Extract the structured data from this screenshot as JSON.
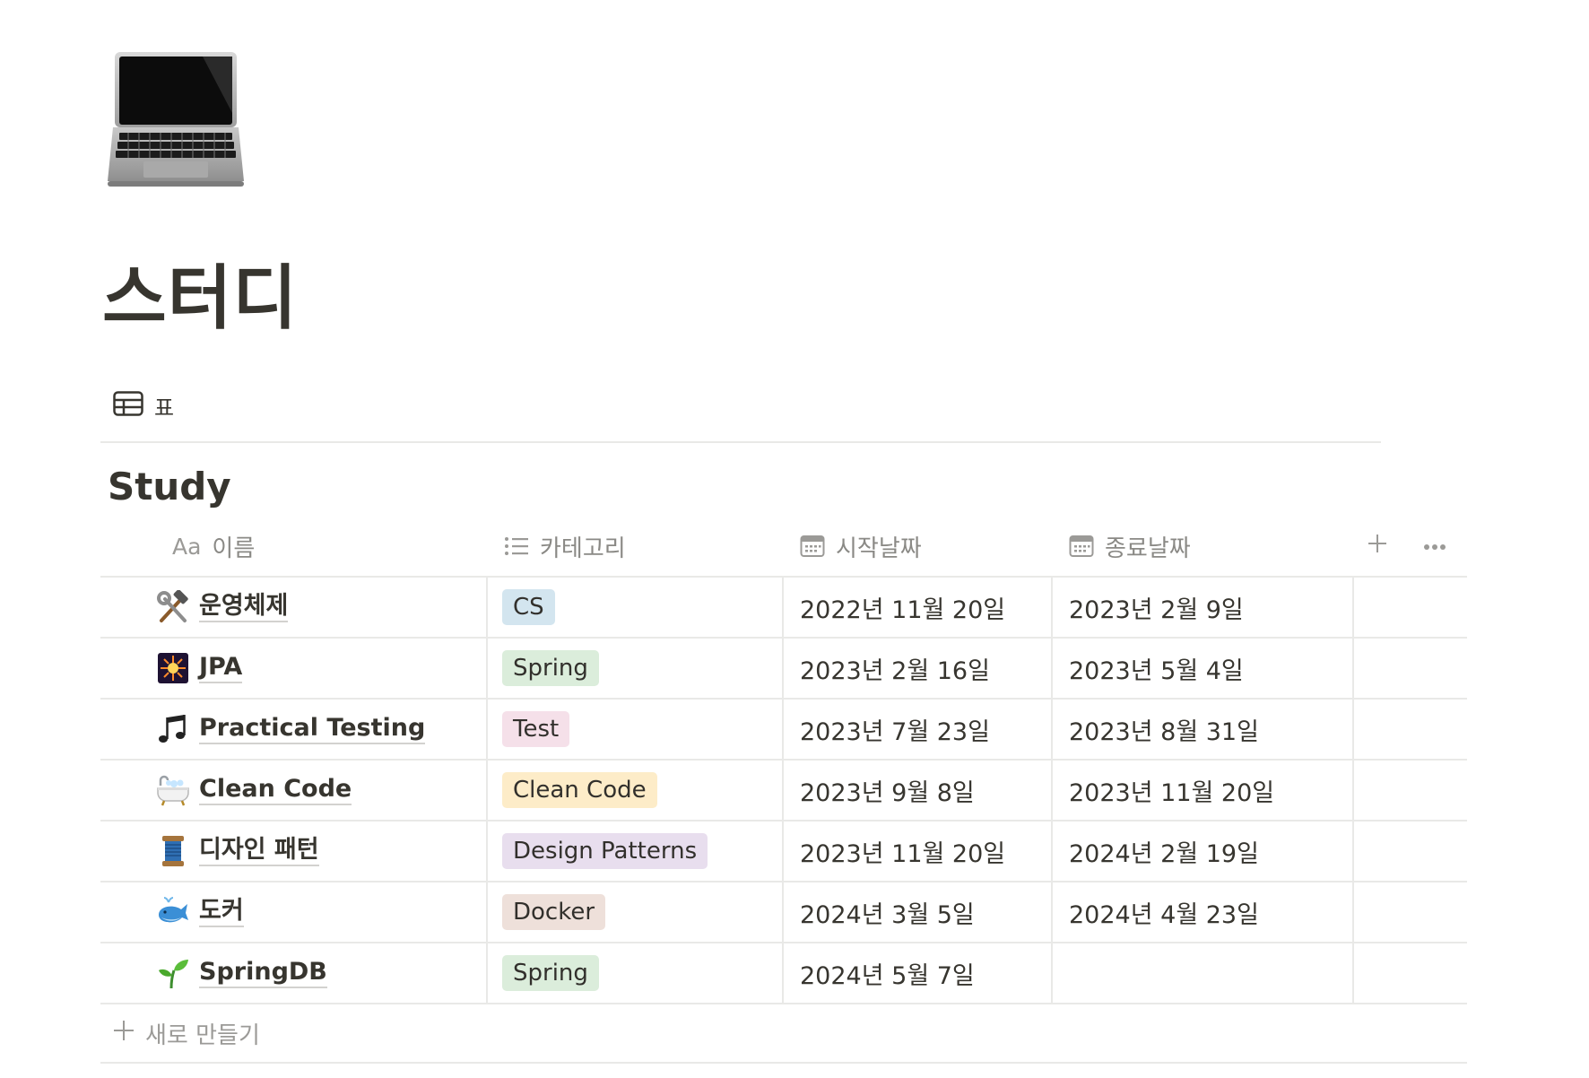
{
  "page": {
    "icon": "laptop-icon",
    "title": "스터디"
  },
  "view": {
    "tab_label": "표",
    "icon": "table-icon"
  },
  "database": {
    "title": "Study",
    "columns": [
      {
        "key": "name",
        "label": "이름",
        "type_icon": "Aa"
      },
      {
        "key": "category",
        "label": "카테고리",
        "type_icon": "list-icon"
      },
      {
        "key": "start",
        "label": "시작날짜",
        "type_icon": "calendar-icon"
      },
      {
        "key": "end",
        "label": "종료날짜",
        "type_icon": "calendar-icon"
      }
    ],
    "add_column_icon": "plus-icon",
    "more_icon": "more-icon",
    "rows": [
      {
        "icon": "hammer-wrench-icon",
        "name": "운영체제",
        "category": "CS",
        "tag_color": "#d3e5ef",
        "start": "2022년 11월 20일",
        "end": "2023년 2월 9일"
      },
      {
        "icon": "sparkler-icon",
        "name": "JPA",
        "category": "Spring",
        "tag_color": "#dbeddb",
        "start": "2023년 2월 16일",
        "end": "2023년 5월 4일"
      },
      {
        "icon": "music-notes-icon",
        "name": "Practical Testing",
        "category": "Test",
        "tag_color": "#f5e0e9",
        "start": "2023년 7월 23일",
        "end": "2023년 8월 31일"
      },
      {
        "icon": "bathtub-icon",
        "name": "Clean Code",
        "category": "Clean Code",
        "tag_color": "#fdecc8",
        "start": "2023년 9월 8일",
        "end": "2023년 11월 20일"
      },
      {
        "icon": "thread-spool-icon",
        "name": "디자인 패턴",
        "category": "Design Patterns",
        "tag_color": "#e8deee",
        "start": "2023년 11월 20일",
        "end": "2024년 2월 19일"
      },
      {
        "icon": "whale-icon",
        "name": "도커",
        "category": "Docker",
        "tag_color": "#eee0da",
        "start": "2024년 3월 5일",
        "end": "2024년 4월 23일"
      },
      {
        "icon": "seedling-icon",
        "name": "SpringDB",
        "category": "Spring",
        "tag_color": "#dbeddb",
        "start": "2024년 5월 7일",
        "end": ""
      }
    ],
    "new_row_label": "새로 만들기"
  }
}
